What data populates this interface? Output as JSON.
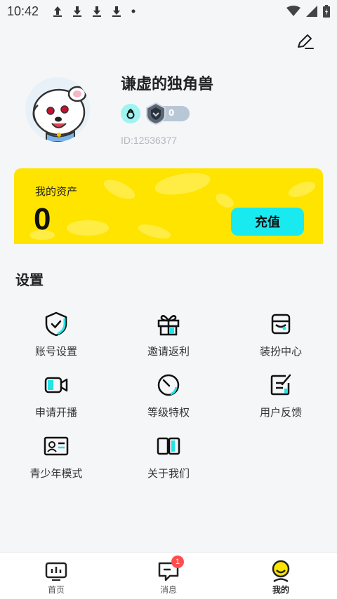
{
  "status_bar": {
    "time": "10:42",
    "icons": [
      "upload-icon",
      "download-icon",
      "download-icon",
      "download-icon",
      "dot-icon"
    ],
    "right_icons": [
      "wifi-icon",
      "signal-icon",
      "battery-icon"
    ]
  },
  "profile": {
    "username": "谦虚的独角兽",
    "level": "0",
    "user_id": "ID:12536377"
  },
  "assets": {
    "label": "我的资产",
    "value": "0",
    "recharge_label": "充值",
    "card_color": "#ffe400",
    "button_color": "#19eaf0"
  },
  "settings": {
    "title": "设置",
    "items": [
      {
        "label": "账号设置",
        "icon": "shield-check-icon"
      },
      {
        "label": "邀请返利",
        "icon": "gift-icon"
      },
      {
        "label": "装扮中心",
        "icon": "wardrobe-icon"
      },
      {
        "label": "申请开播",
        "icon": "video-camera-icon"
      },
      {
        "label": "等级特权",
        "icon": "gauge-icon"
      },
      {
        "label": "用户反馈",
        "icon": "feedback-edit-icon"
      },
      {
        "label": "青少年模式",
        "icon": "id-card-icon"
      },
      {
        "label": "关于我们",
        "icon": "book-icon"
      }
    ]
  },
  "tabbar": {
    "tabs": [
      {
        "label": "首页",
        "icon": "home-chart-icon"
      },
      {
        "label": "消息",
        "icon": "message-icon",
        "badge": "1"
      },
      {
        "label": "我的",
        "icon": "profile-smile-icon",
        "active": true
      }
    ]
  }
}
